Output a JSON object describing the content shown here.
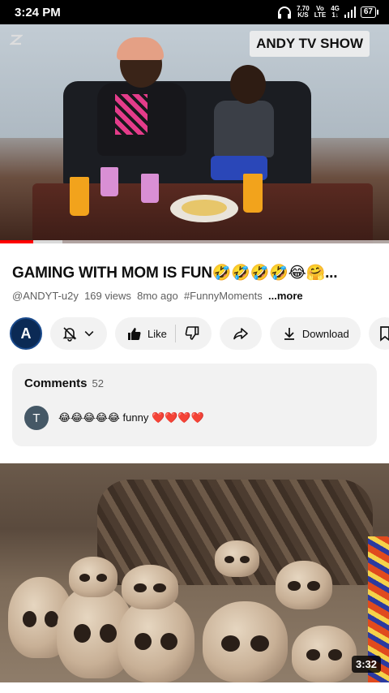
{
  "status_bar": {
    "time": "3:24 PM",
    "speed_value": "7.70",
    "speed_unit": "K/S",
    "volte_top": "Vo",
    "volte_bottom": "LTE",
    "network_top": "4G",
    "network_bottom": "1↓",
    "battery": "67"
  },
  "player": {
    "watermark_text": "ANDY TV SHOW",
    "progress_played": 0.085,
    "progress_buffered": 0.16
  },
  "video": {
    "title": "GAMING WITH MOM  IS FUN🤣🤣🤣🤣😂🤗...",
    "channel_handle": "@ANDYT-u2y",
    "views": "169 views",
    "age": "8mo ago",
    "hashtag": "#FunnyMoments",
    "more_label": "...more"
  },
  "actions": {
    "channel_avatar_letter": "A",
    "like_label": "Like",
    "download_label": "Download"
  },
  "comments": {
    "heading": "Comments",
    "count": "52",
    "top_comment": {
      "avatar_letter": "T",
      "text": "😂😂😂😂😂 funny ❤️❤️❤️❤️"
    }
  },
  "next_video": {
    "duration": "3:32"
  },
  "colors": {
    "accent_red": "#ff0000",
    "pill_bg": "#f2f2f2"
  }
}
